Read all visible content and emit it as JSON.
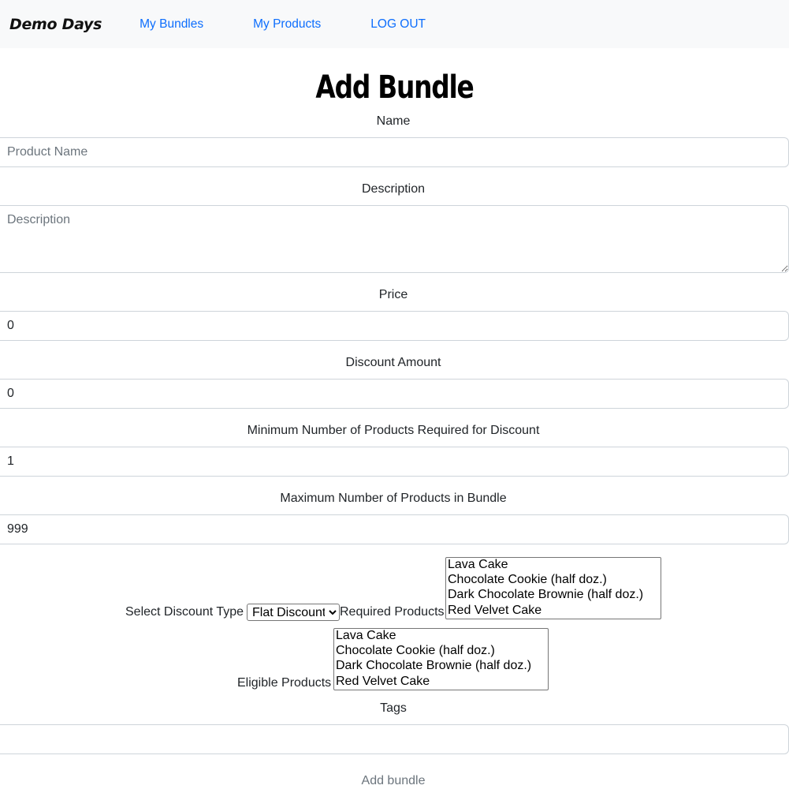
{
  "navbar": {
    "brand": "Demo Days",
    "links": [
      "My Bundles",
      "My Products",
      "LOG OUT"
    ]
  },
  "page_title": "Add Bundle",
  "form": {
    "name": {
      "label": "Name",
      "placeholder": "Product Name",
      "value": ""
    },
    "description": {
      "label": "Description",
      "placeholder": "Description",
      "value": ""
    },
    "price": {
      "label": "Price",
      "value": "0"
    },
    "discount_amount": {
      "label": "Discount Amount",
      "value": "0"
    },
    "min_products": {
      "label": "Minimum Number of Products Required for Discount",
      "value": "1"
    },
    "max_products": {
      "label": "Maximum Number of Products in Bundle",
      "value": "999"
    },
    "discount_type": {
      "label": "Select Discount Type",
      "selected": "Flat Discount"
    },
    "required_products": {
      "label": "Required Products",
      "options": [
        "Lava Cake",
        "Chocolate Cookie (half doz.)",
        "Dark Chocolate Brownie (half doz.)",
        "Red Velvet Cake"
      ]
    },
    "eligible_products": {
      "label": "Eligible Products",
      "options": [
        "Lava Cake",
        "Chocolate Cookie (half doz.)",
        "Dark Chocolate Brownie (half doz.)",
        "Red Velvet Cake"
      ]
    },
    "tags": {
      "label": "Tags",
      "value": ""
    },
    "submit_label": "Add bundle"
  }
}
